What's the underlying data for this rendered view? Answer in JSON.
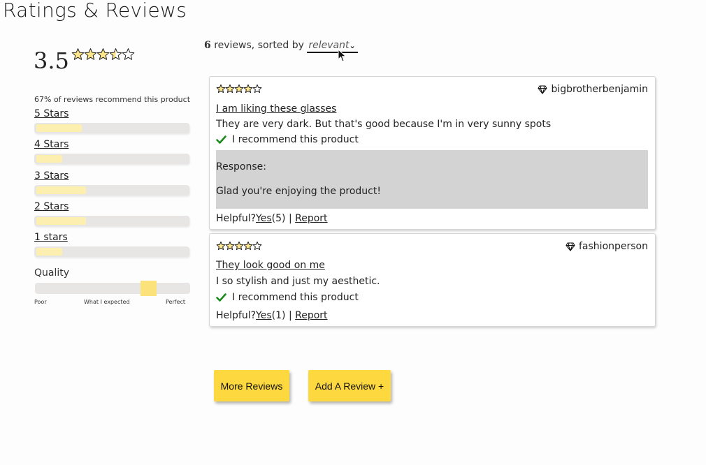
{
  "page_title": "Ratings & Reviews",
  "summary": {
    "average": "3.5",
    "average_stars": 3.5,
    "recommend_text": "67% of reviews recommend this product",
    "breakdown": [
      {
        "label": "5 Stars",
        "share": 0.3
      },
      {
        "label": "4 Stars",
        "share": 0.17
      },
      {
        "label": "3 Stars",
        "share": 0.33
      },
      {
        "label": "2 Stars",
        "share": 0.33
      },
      {
        "label": "1 stars",
        "share": 0.17
      }
    ],
    "characteristic": {
      "name": "Quality",
      "value": 0.76,
      "scale": [
        "Poor",
        "What I expected",
        "Perfect"
      ]
    }
  },
  "sort": {
    "count": "6",
    "text": "reviews, sorted by",
    "selected": "relevant"
  },
  "reviews": [
    {
      "stars": 4,
      "username": "bigbrotherbenjamin",
      "summary": "I am liking these glasses",
      "body": "They are very dark. But that's good because I'm in very sunny spots",
      "recommend": "I recommend this product",
      "response_label": "Response:",
      "response_text": "Glad you're enjoying the product!",
      "helpful_label": "Helpful?",
      "yes_label": "Yes",
      "yes_count": "(5)",
      "separator": " | ",
      "report_label": "Report"
    },
    {
      "stars": 4,
      "username": "fashionperson",
      "summary": "They look good on me",
      "body": "I so stylish and just my aesthetic.",
      "recommend": "I recommend this product",
      "helpful_label": "Helpful?",
      "yes_label": "Yes",
      "yes_count": "(1)",
      "separator": " | ",
      "report_label": "Report"
    }
  ],
  "buttons": {
    "more_reviews": "More Reviews",
    "add_review": "Add A Review +"
  },
  "colors": {
    "accent": "#fdd83e",
    "bar_fill": "#fcefb0",
    "check": "#1a8a1a",
    "response_bg": "#d3d3d3"
  }
}
